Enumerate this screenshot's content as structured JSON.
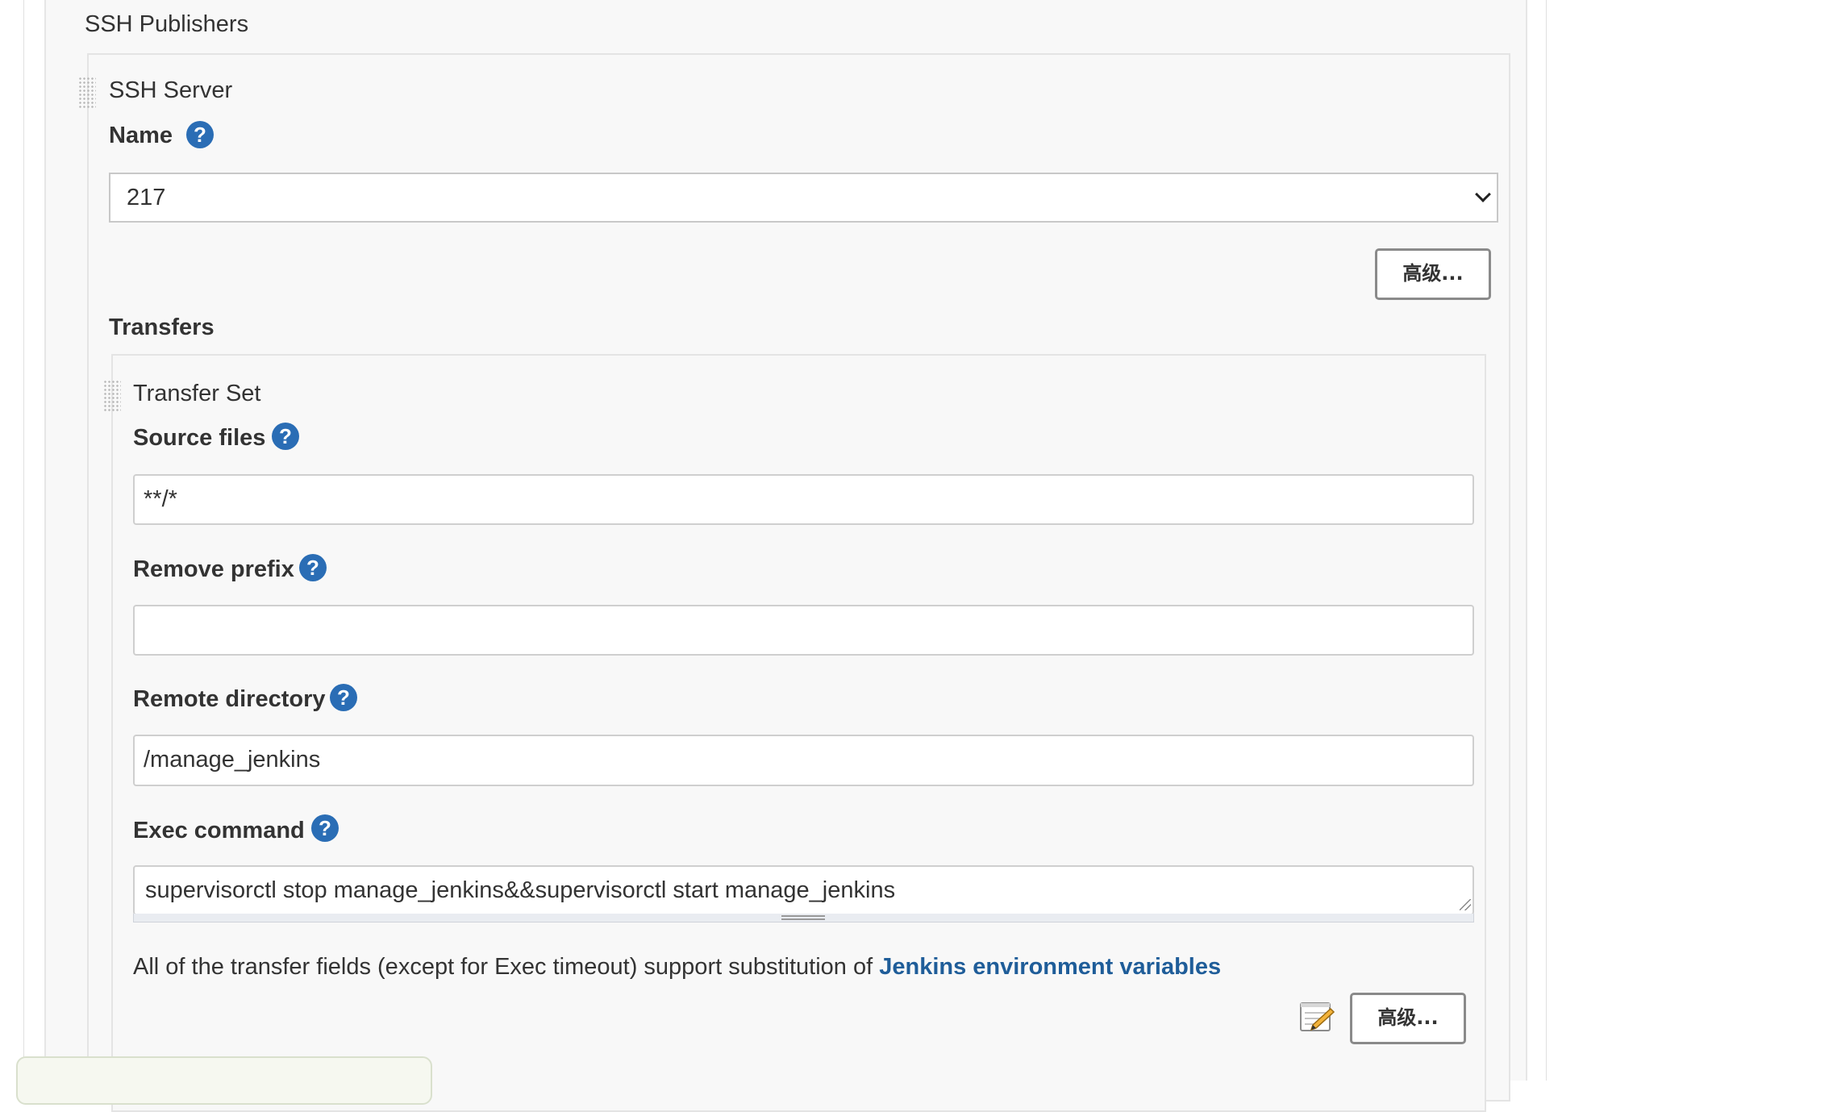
{
  "ssh_publishers": {
    "title": "SSH Publishers",
    "ssh_server": {
      "title": "SSH Server",
      "name_label": "Name",
      "name_help": "?",
      "name_value": "217",
      "advanced_button": "高级..."
    },
    "transfers": {
      "title": "Transfers",
      "transfer_set": {
        "title": "Transfer Set",
        "source_files": {
          "label": "Source files",
          "help": "?",
          "value": "**/*"
        },
        "remove_prefix": {
          "label": "Remove prefix",
          "help": "?",
          "value": ""
        },
        "remote_directory": {
          "label": "Remote directory",
          "help": "?",
          "value": "/manage_jenkins"
        },
        "exec_command": {
          "label": "Exec command",
          "help": "?",
          "value": "supervisorctl stop manage_jenkins&&supervisorctl start manage_jenkins"
        },
        "note_text": "All of the transfer fields (except for Exec timeout) support substitution of ",
        "note_link": "Jenkins environment variables",
        "advanced_button": "高级..."
      }
    }
  },
  "icons": {
    "help": "help-icon",
    "drag": "drag-handle-icon",
    "notepad": "notepad-icon",
    "dropdown": "chevron-down-icon"
  },
  "colors": {
    "help_icon": "#2a6db5",
    "link": "#1f5d99",
    "panel_bg": "#f8f8f8"
  }
}
